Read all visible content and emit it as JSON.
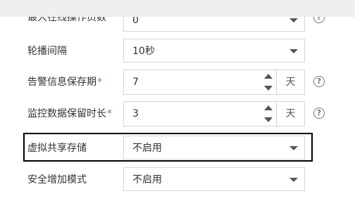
{
  "icons": {
    "help": "?"
  },
  "rows": {
    "max_online": {
      "label": "最大在线操作员数",
      "value": "0"
    },
    "interval": {
      "label": "轮播间隔",
      "value": "10秒"
    },
    "alarm_keep": {
      "label": "告警信息保存期",
      "required": "*",
      "value": "7",
      "unit": "天"
    },
    "monitor_keep": {
      "label": "监控数据保留时长",
      "required": "*",
      "value": "3",
      "unit": "天"
    },
    "vshare": {
      "label": "虚拟共享存储",
      "value": "不启用"
    },
    "security": {
      "label": "安全增加模式",
      "value": "不启用"
    }
  },
  "colors": {
    "required": "#e74c3c",
    "border": "#d4d4d4",
    "highlight": "#000000",
    "topbar": "#efefef"
  }
}
